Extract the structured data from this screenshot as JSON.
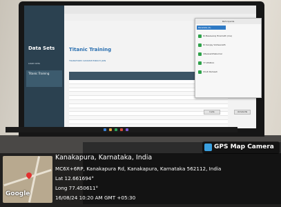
{
  "photo": {
    "description_colors": {
      "wall": "#e9e6df",
      "desk": "#4a4846",
      "overlay": "#000000"
    }
  },
  "screen": {
    "sidebar": {
      "title": "Data Sets",
      "item": "LOAD DATA",
      "selected": "Titanic Training"
    },
    "dataset": {
      "title": "Titanic Training",
      "subtitle": "",
      "toolbar": "TRANSFORM  CLEANSE  ENRICH  JOIN"
    },
    "participants_panel": {
      "title": "Participants",
      "tab": "Panelists (5)",
      "rows": [
        {
          "name": "Dr.Basavaraj Hiremath (me)"
        },
        {
          "name": "Dr.Sanjay Vishwanath"
        },
        {
          "name": "dlbvasanthakumar"
        },
        {
          "name": "77.450611"
        },
        {
          "name": "Chuti Ramesh"
        }
      ],
      "button_left": "Invite",
      "button_right": "Unmute Me"
    }
  },
  "gps_stamp": {
    "brand": "GPS Map Camera",
    "place": "Kanakapura, Karnataka, India",
    "address": "MC6X+6RP, Kanakapura Rd, Kanakapura, Karnataka 562112, India",
    "lat": "Lat 12.661694°",
    "long": "Long 77.450611°",
    "datetime": "16/08/24 10:20 AM GMT +05:30",
    "map_label": "Google"
  }
}
